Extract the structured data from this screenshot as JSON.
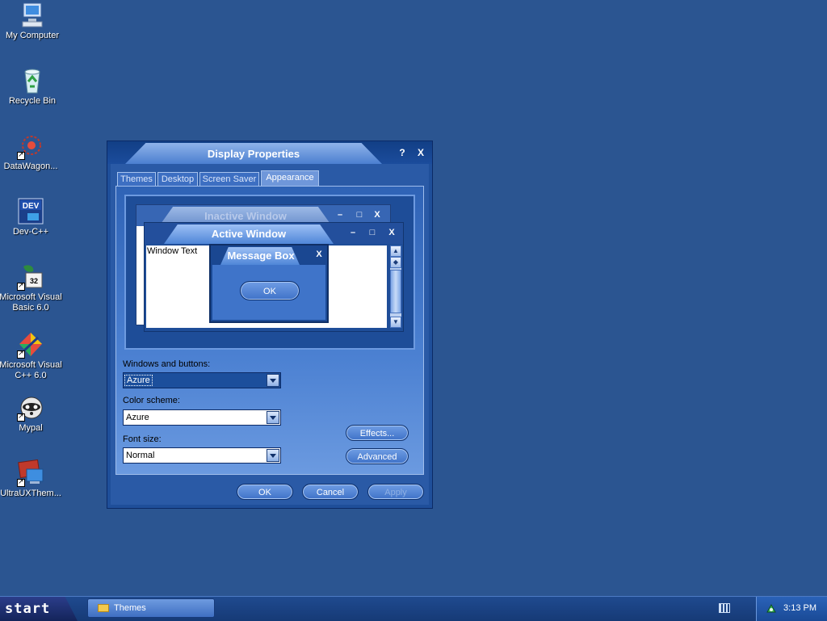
{
  "desktop": {
    "icons": [
      {
        "label": "My Computer",
        "icon": "computer-icon"
      },
      {
        "label": "Recycle Bin",
        "icon": "recycle-bin-icon"
      },
      {
        "label": "DataWagon...",
        "icon": "datawagon-icon"
      },
      {
        "label": "Dev-C++",
        "icon": "dev-cpp-icon"
      },
      {
        "label": "Microsoft Visual Basic 6.0",
        "icon": "visual-basic-icon"
      },
      {
        "label": "Microsoft Visual C++ 6.0",
        "icon": "visual-cpp-icon"
      },
      {
        "label": "Mypal",
        "icon": "mypal-icon"
      },
      {
        "label": "UltraUXThem...",
        "icon": "ultrauxtheme-icon"
      }
    ],
    "devcpp_badge": "DEV",
    "vb_badge": "32"
  },
  "dialog": {
    "title": "Display Properties",
    "help_button": "?",
    "close_button": "X",
    "tabs": [
      "Themes",
      "Desktop",
      "Screen Saver",
      "Appearance"
    ],
    "active_tab": "Appearance",
    "preview": {
      "inactive_title": "Inactive Window",
      "active_title": "Active Window",
      "window_text": "Window Text",
      "message_box_title": "Message Box",
      "message_box_close": "X",
      "ok_label": "OK",
      "min_glyph": "–",
      "max_glyph": "□",
      "close_glyph": "X"
    },
    "fields": {
      "windows_buttons_label": "Windows and buttons:",
      "windows_buttons_value": "Azure",
      "color_scheme_label": "Color scheme:",
      "color_scheme_value": "Azure",
      "font_size_label": "Font size:",
      "font_size_value": "Normal"
    },
    "effects_button": "Effects...",
    "advanced_button": "Advanced",
    "ok_button": "OK",
    "cancel_button": "Cancel",
    "apply_button": "Apply"
  },
  "taskbar": {
    "start_label": "start",
    "task_label": "Themes",
    "clock": "3:13 PM"
  },
  "colors": {
    "desktop_bg": "#2b5591",
    "dialog_bg": "#2a5aa6",
    "accent": "#4f86d8"
  }
}
